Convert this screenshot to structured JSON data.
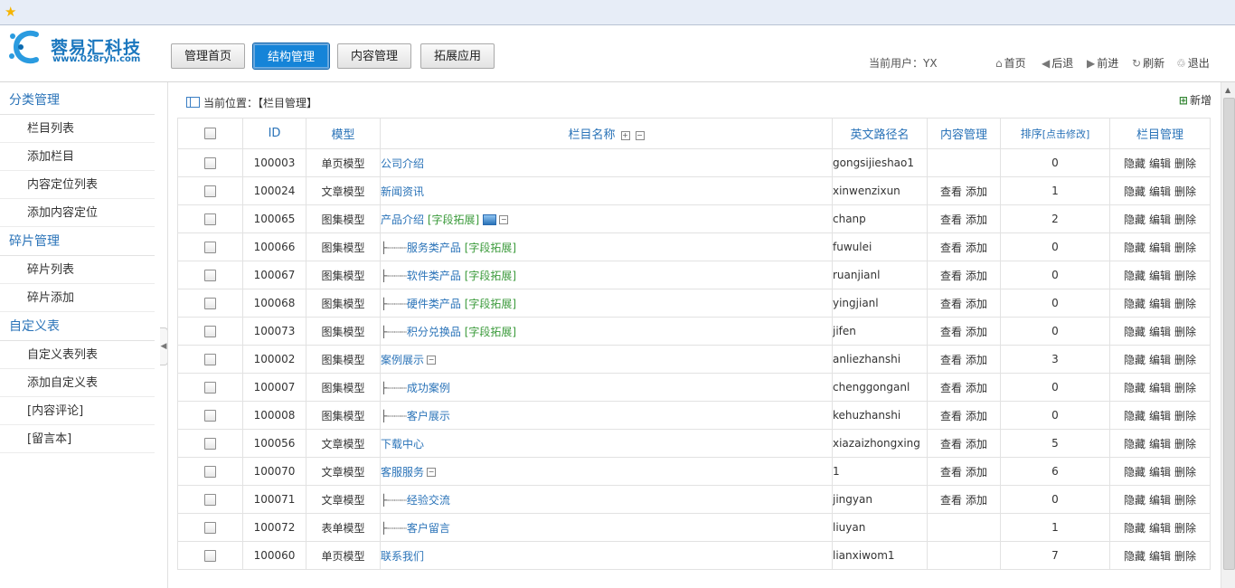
{
  "header": {
    "brand": "蓉易汇科技",
    "site": "www.028ryh.com",
    "nav": [
      "管理首页",
      "结构管理",
      "内容管理",
      "拓展应用"
    ],
    "active_nav": "结构管理",
    "current_user": "当前用户：YX",
    "links": [
      "首页",
      "后退",
      "前进",
      "刷新",
      "退出"
    ]
  },
  "sidebar": {
    "groups": [
      {
        "title": "分类管理",
        "items": [
          "栏目列表",
          "添加栏目",
          "内容定位列表",
          "添加内容定位"
        ]
      },
      {
        "title": "碎片管理",
        "items": [
          "碎片列表",
          "碎片添加"
        ]
      },
      {
        "title": "自定义表",
        "items": [
          "自定义表列表",
          "添加自定义表",
          "[内容评论]",
          "[留言本]"
        ]
      }
    ]
  },
  "main": {
    "breadcrumb": "当前位置：【栏目管理】",
    "add_new": "新增",
    "columns": [
      "ID",
      "模型",
      "栏目名称",
      "英文路径名",
      "内容管理",
      "排序[点击修改]",
      "栏目管理"
    ],
    "action_labels": {
      "view": "查看",
      "add": "添加",
      "hide": "隐藏",
      "edit": "编辑",
      "delete": "删除"
    },
    "ext_label": "[字段拓展]",
    "rows": [
      {
        "id": "100003",
        "model": "单页模型",
        "prefix": "",
        "name": "公司介绍",
        "ext": false,
        "img": false,
        "collapse": false,
        "en": "gongsijieshao1",
        "content": false,
        "sort": "0"
      },
      {
        "id": "100024",
        "model": "文章模型",
        "prefix": "",
        "name": "新闻资讯",
        "ext": false,
        "img": false,
        "collapse": false,
        "en": "xinwenzixun",
        "content": true,
        "sort": "1"
      },
      {
        "id": "100065",
        "model": "图集模型",
        "prefix": "",
        "name": "产品介绍",
        "ext": true,
        "img": true,
        "collapse": true,
        "en": "chanp",
        "content": true,
        "sort": "2"
      },
      {
        "id": "100066",
        "model": "图集模型",
        "prefix": "├┈┈┈",
        "name": "服务类产品",
        "ext": true,
        "img": false,
        "collapse": false,
        "en": "fuwulei",
        "content": true,
        "sort": "0"
      },
      {
        "id": "100067",
        "model": "图集模型",
        "prefix": "├┈┈┈",
        "name": "软件类产品",
        "ext": true,
        "img": false,
        "collapse": false,
        "en": "ruanjianl",
        "content": true,
        "sort": "0"
      },
      {
        "id": "100068",
        "model": "图集模型",
        "prefix": "├┈┈┈",
        "name": "硬件类产品",
        "ext": true,
        "img": false,
        "collapse": false,
        "en": "yingjianl",
        "content": true,
        "sort": "0"
      },
      {
        "id": "100073",
        "model": "图集模型",
        "prefix": "├┈┈┈",
        "name": "积分兑换品",
        "ext": true,
        "img": false,
        "collapse": false,
        "en": "jifen",
        "content": true,
        "sort": "0"
      },
      {
        "id": "100002",
        "model": "图集模型",
        "prefix": "",
        "name": "案例展示",
        "ext": false,
        "img": false,
        "collapse": true,
        "en": "anliezhanshi",
        "content": true,
        "sort": "3"
      },
      {
        "id": "100007",
        "model": "图集模型",
        "prefix": "├┈┈┈",
        "name": "成功案例",
        "ext": false,
        "img": false,
        "collapse": false,
        "en": "chenggonganl",
        "content": true,
        "sort": "0"
      },
      {
        "id": "100008",
        "model": "图集模型",
        "prefix": "├┈┈┈",
        "name": "客户展示",
        "ext": false,
        "img": false,
        "collapse": false,
        "en": "kehuzhanshi",
        "content": true,
        "sort": "0"
      },
      {
        "id": "100056",
        "model": "文章模型",
        "prefix": "",
        "name": "下载中心",
        "ext": false,
        "img": false,
        "collapse": false,
        "en": "xiazaizhongxing",
        "content": true,
        "sort": "5"
      },
      {
        "id": "100070",
        "model": "文章模型",
        "prefix": "",
        "name": "客服服务",
        "ext": false,
        "img": false,
        "collapse": true,
        "en": "1",
        "content": true,
        "sort": "6"
      },
      {
        "id": "100071",
        "model": "文章模型",
        "prefix": "├┈┈┈",
        "name": "经验交流",
        "ext": false,
        "img": false,
        "collapse": false,
        "en": "jingyan",
        "content": true,
        "sort": "0"
      },
      {
        "id": "100072",
        "model": "表单模型",
        "prefix": "├┈┈┈",
        "name": "客户留言",
        "ext": false,
        "img": false,
        "collapse": false,
        "en": "liuyan",
        "content": false,
        "sort": "1"
      },
      {
        "id": "100060",
        "model": "单页模型",
        "prefix": "",
        "name": "联系我们",
        "ext": false,
        "img": false,
        "collapse": false,
        "en": "lianxiwom1",
        "content": false,
        "sort": "7"
      }
    ]
  }
}
